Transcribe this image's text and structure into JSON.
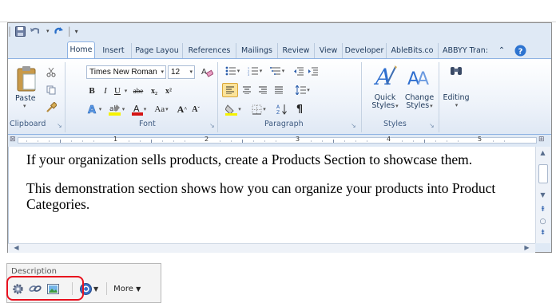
{
  "ribbon": {
    "tabs": [
      "Home",
      "Insert",
      "Page Layou",
      "References",
      "Mailings",
      "Review",
      "View",
      "Developer",
      "AbleBits.co",
      "ABBYY Tran:"
    ],
    "groups": {
      "clipboard": {
        "label": "Clipboard",
        "paste": "Paste"
      },
      "font": {
        "label": "Font",
        "name": "Times New Roman",
        "size": "12",
        "bold": "B",
        "italic": "I",
        "underline": "U",
        "strike": "abe",
        "subscript": "x₂",
        "superscript": "x²",
        "change_case": "Aa",
        "grow": "A",
        "shrink": "A"
      },
      "paragraph": {
        "label": "Paragraph",
        "pilcrow": "¶"
      },
      "styles": {
        "label": "Styles",
        "quick": "Quick",
        "quick2": "Styles",
        "change": "Change",
        "change2": "Styles"
      },
      "editing": {
        "label": "Editing"
      }
    },
    "ruler_numbers": [
      "1",
      "2",
      "3",
      "4",
      "5"
    ]
  },
  "document": {
    "paragraphs": [
      "If your organization sells products, create a Products Section to showcase them.",
      "This demonstration section shows how you can organize your products into Product Categories."
    ]
  },
  "description": {
    "label": "Description",
    "more": "More"
  },
  "colors": {
    "accent": "#8db2e3",
    "highlight": "#e8101e"
  }
}
